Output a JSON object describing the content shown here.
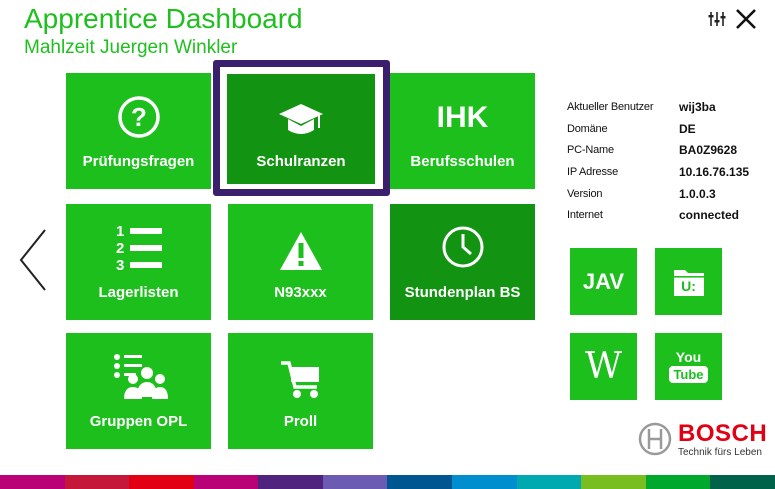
{
  "header": {
    "title": "Apprentice Dashboard",
    "subtitle": "Mahlzeit Juergen Winkler",
    "settings_icon": "settings-sliders-icon",
    "close_icon": "close-icon"
  },
  "tiles": [
    {
      "label": "Prüfungsfragen",
      "icon": "question-circle-icon"
    },
    {
      "label": "Schulranzen",
      "icon": "graduation-cap-icon",
      "selected": true
    },
    {
      "label": "Berufsschulen",
      "icon_text": "IHK"
    },
    {
      "label": "Lagerlisten",
      "icon": "numbered-list-icon"
    },
    {
      "label": "N93xxx",
      "icon": "warning-icon"
    },
    {
      "label": "Stundenplan BS",
      "icon": "clock-icon"
    },
    {
      "label": "Gruppen OPL",
      "icon": "group-people-icon"
    },
    {
      "label": "Proll",
      "icon": "shopping-cart-icon"
    }
  ],
  "info": {
    "rows": [
      {
        "key": "Aktueller Benutzer",
        "value": "wij3ba"
      },
      {
        "key": "Domäne",
        "value": "DE"
      },
      {
        "key": "PC-Name",
        "value": "BA0Z9628"
      },
      {
        "key": "IP Adresse",
        "value": "10.16.76.135"
      },
      {
        "key": "Version",
        "value": "1.0.0.3"
      },
      {
        "key": "Internet",
        "value": "connected"
      }
    ]
  },
  "shortcuts": {
    "jav_label": "JAV",
    "drive_label": "U:",
    "wiki_label": "W",
    "youtube_top": "You",
    "youtube_bottom": "Tube"
  },
  "brand": {
    "name": "BOSCH",
    "tagline": "Technik fürs Leben"
  },
  "colors": {
    "accent": "#1fbf1f",
    "tile": "#1dbf1d",
    "tile_dark": "#129312",
    "selection": "#3a1f6e",
    "bosch_red": "#e20015"
  }
}
